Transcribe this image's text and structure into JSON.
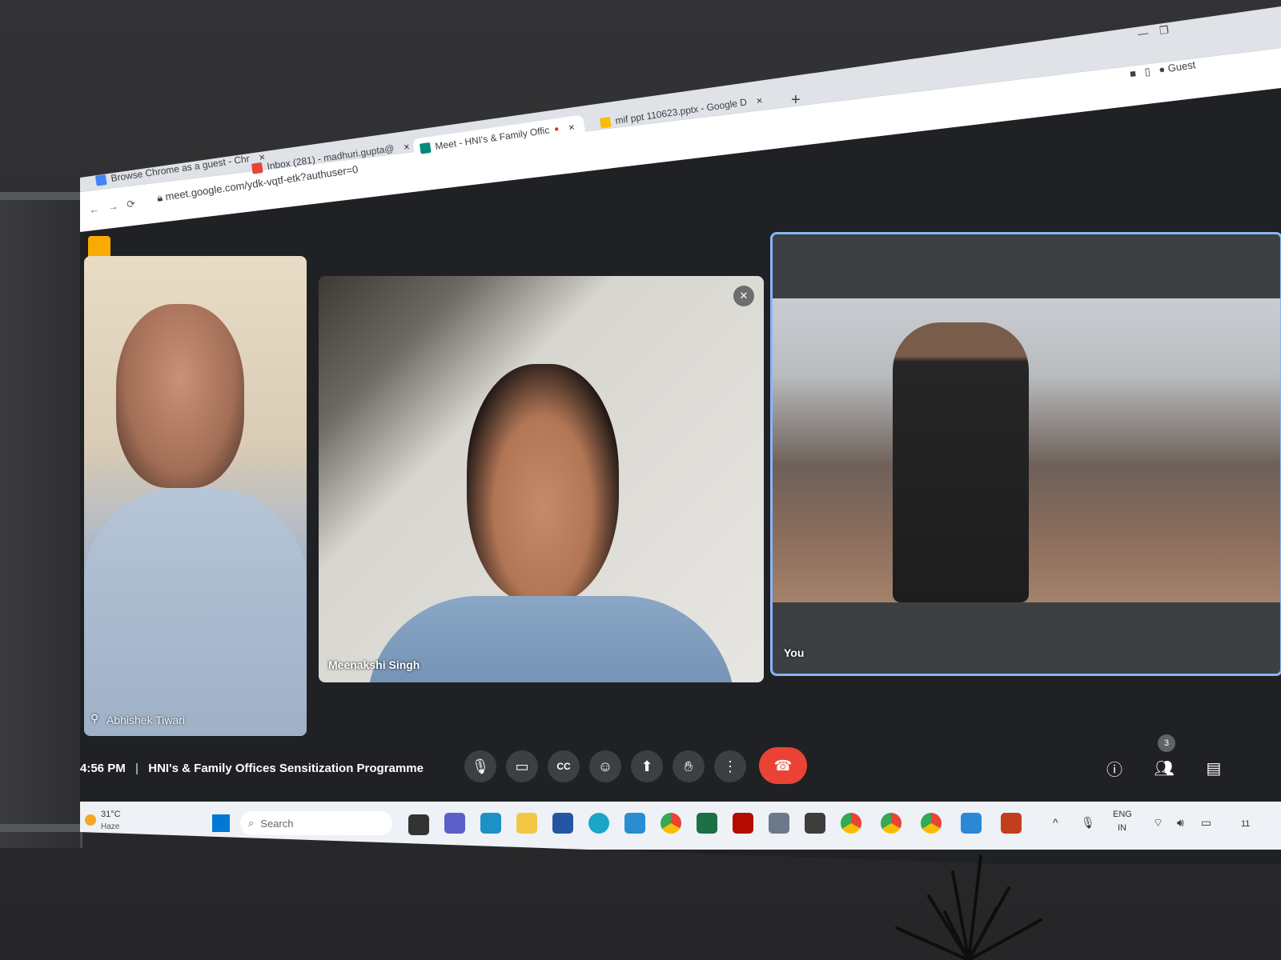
{
  "browser": {
    "tabs": [
      {
        "label": "Browse Chrome as a guest - Chr",
        "icon": "google-icon"
      },
      {
        "label": "Inbox (281) - madhuri.gupta@",
        "icon": "gmail-icon"
      },
      {
        "label": "Meet - HNI's & Family Offic",
        "icon": "meet-icon",
        "active": true
      },
      {
        "label": "mif ppt 110623.pptx - Google D",
        "icon": "drive-icon"
      }
    ],
    "new_tab": "+",
    "url": "meet.google.com/ydk-vqtf-etk?authuser=0",
    "profile_label": "Guest"
  },
  "meet": {
    "participants": [
      {
        "name": "Abhishek Tiwari"
      },
      {
        "name": "Meenakshi Singh"
      },
      {
        "name": "You"
      }
    ],
    "time": "4:56 PM",
    "meeting_title": "HNI's & Family Offices Sensitization Programme",
    "people_count": "3",
    "controls": [
      {
        "name": "microphone",
        "icon": "microphone-icon"
      },
      {
        "name": "camera",
        "icon": "camera-icon"
      },
      {
        "name": "captions",
        "icon": "captions-icon"
      },
      {
        "name": "reactions",
        "icon": "emoji-icon"
      },
      {
        "name": "present",
        "icon": "present-icon"
      },
      {
        "name": "raise-hand",
        "icon": "hand-icon"
      },
      {
        "name": "more",
        "icon": "more-vert-icon"
      }
    ],
    "end_call_color": "#ea4335",
    "accent_color": "#8ab4f8"
  },
  "taskbar": {
    "weather_temp": "31°C",
    "weather_desc": "Haze",
    "search_placeholder": "Search",
    "lang_top": "ENG",
    "lang_bottom": "IN",
    "clock": "11"
  }
}
